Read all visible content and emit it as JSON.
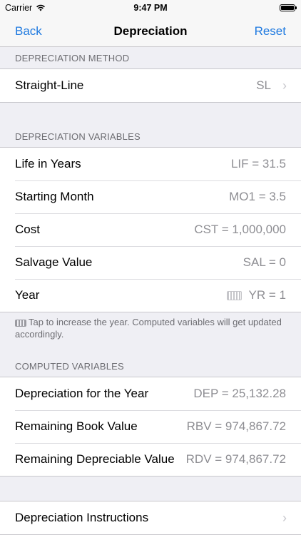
{
  "status_bar": {
    "carrier": "Carrier",
    "time": "9:47 PM"
  },
  "nav": {
    "back": "Back",
    "title": "Depreciation",
    "reset": "Reset"
  },
  "method": {
    "header": "DEPRECIATION METHOD",
    "row": {
      "label": "Straight-Line",
      "value": "SL"
    }
  },
  "variables": {
    "header": "DEPRECIATION VARIABLES",
    "rows": [
      {
        "label": "Life in Years",
        "value": "LIF = 31.5"
      },
      {
        "label": "Starting Month",
        "value": "MO1 = 3.5"
      },
      {
        "label": "Cost",
        "value": "CST = 1,000,000"
      },
      {
        "label": "Salvage Value",
        "value": "SAL = 0"
      },
      {
        "label": "Year",
        "value": "YR = 1",
        "icon": "keyboard-icon"
      }
    ],
    "footnote": "Tap to increase the year. Computed variables will get updated accordingly."
  },
  "computed": {
    "header": "COMPUTED VARIABLES",
    "rows": [
      {
        "label": "Depreciation for the Year",
        "value": "DEP = 25,132.28"
      },
      {
        "label": "Remaining Book Value",
        "value": "RBV = 974,867.72"
      },
      {
        "label": "Remaining Depreciable Value",
        "value": "RDV = 974,867.72"
      }
    ]
  },
  "instructions": {
    "label": "Depreciation Instructions"
  },
  "colors": {
    "accent": "#1f7ae0",
    "secondary_text": "#8e8e93",
    "background": "#efeff4"
  }
}
